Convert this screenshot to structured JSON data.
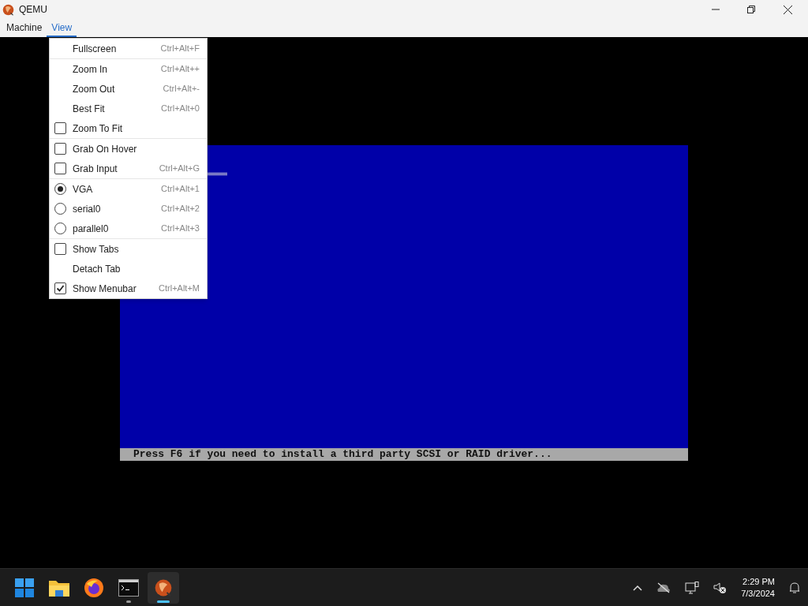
{
  "window": {
    "title": "QEMU"
  },
  "menubar": [
    {
      "label": "Machine",
      "selected": false
    },
    {
      "label": "View",
      "selected": true
    }
  ],
  "view_menu": {
    "groups": [
      [
        {
          "kind": "plain",
          "label": "Fullscreen",
          "shortcut": "Ctrl+Alt+F"
        }
      ],
      [
        {
          "kind": "plain",
          "label": "Zoom In",
          "shortcut": "Ctrl+Alt++"
        },
        {
          "kind": "plain",
          "label": "Zoom Out",
          "shortcut": "Ctrl+Alt+-"
        },
        {
          "kind": "plain",
          "label": "Best Fit",
          "shortcut": "Ctrl+Alt+0"
        },
        {
          "kind": "checkbox",
          "label": "Zoom To Fit",
          "checked": false
        }
      ],
      [
        {
          "kind": "checkbox",
          "label": "Grab On Hover",
          "checked": false
        },
        {
          "kind": "checkbox",
          "label": "Grab Input",
          "shortcut": "Ctrl+Alt+G",
          "checked": false
        }
      ],
      [
        {
          "kind": "radio",
          "label": "VGA",
          "shortcut": "Ctrl+Alt+1",
          "selected": true
        },
        {
          "kind": "radio",
          "label": "serial0",
          "shortcut": "Ctrl+Alt+2",
          "selected": false
        },
        {
          "kind": "radio",
          "label": "parallel0",
          "shortcut": "Ctrl+Alt+3",
          "selected": false
        }
      ],
      [
        {
          "kind": "checkbox",
          "label": "Show Tabs",
          "checked": false
        },
        {
          "kind": "plain",
          "label": "Detach Tab"
        },
        {
          "kind": "checkbox",
          "label": "Show Menubar",
          "shortcut": "Ctrl+Alt+M",
          "checked": true
        }
      ]
    ]
  },
  "vm_screen": {
    "status_line": "Press F6 if you need to install a third party SCSI or RAID driver..."
  },
  "taskbar": {
    "apps": [
      {
        "kind": "start",
        "running": false,
        "active": false
      },
      {
        "kind": "folder",
        "running": false,
        "active": false
      },
      {
        "kind": "browser",
        "running": false,
        "active": false
      },
      {
        "kind": "terminal",
        "running": true,
        "active": false
      },
      {
        "kind": "qemu",
        "running": true,
        "active": true
      }
    ],
    "clock": {
      "time": "2:29 PM",
      "date": "7/3/2024"
    }
  }
}
